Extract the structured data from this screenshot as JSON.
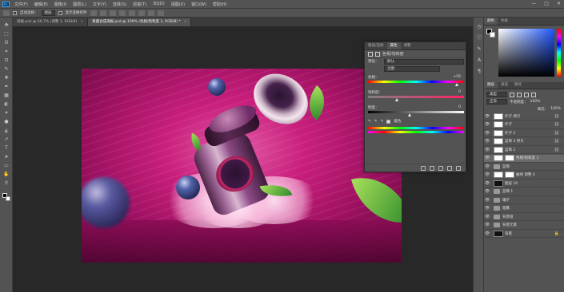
{
  "app": {
    "logo_text": "Ps"
  },
  "menu": [
    "文件(F)",
    "编辑(E)",
    "图像(I)",
    "图层(L)",
    "文字(Y)",
    "选择(S)",
    "滤镜(T)",
    "3D(D)",
    "视图(V)",
    "窗口(W)",
    "帮助(H)"
  ],
  "window_controls": {
    "minimize": "—",
    "maximize": "□",
    "close": "✕"
  },
  "options": {
    "auto_select_label": "自动选择：",
    "auto_select_value": "图层",
    "transform_label": "显示变换控件"
  },
  "tabs": [
    {
      "label": "海报.psd @ 66.7% (调整 3, RGB/8)",
      "active": false
    },
    {
      "label": "果酱合成海报.psd @ 100% (色相/饱和度 1, RGB/8) *",
      "active": true
    }
  ],
  "tab_close": "×",
  "tools": [
    "✥",
    "⬚",
    "ʘ",
    "⌗",
    "⊡",
    "✎",
    "✚",
    "✒",
    "▦",
    "◐",
    "✦",
    "●",
    "◭",
    "➚",
    "T",
    "➤",
    "▭",
    "✋",
    "⚲"
  ],
  "properties_panel": {
    "tabs": [
      "路径/选择",
      "属性",
      "调整"
    ],
    "active_tab": "属性",
    "title": "色相/饱和度",
    "preset_label": "预设：",
    "preset_value": "默认",
    "channel_value": "全图",
    "hue_label": "色相：",
    "hue_value": "+56",
    "saturation_label": "饱和度：",
    "saturation_value": "0",
    "lightness_label": "明度：",
    "lightness_value": "0",
    "colorize_label": "着色"
  },
  "color_panel": {
    "tabs": [
      "颜色",
      "色板"
    ],
    "active_tab": "颜色"
  },
  "layers_panel": {
    "tabs": [
      "图层",
      "通道",
      "路径"
    ],
    "active_tab": "图层",
    "kind_value": "类型",
    "blend_value": "正常",
    "opacity_label": "不透明度：",
    "opacity_value": "100%",
    "fill_label": "填充：",
    "fill_value": "100%",
    "layers": [
      {
        "name": "叶子 拷贝",
        "kind": "layer",
        "visible": true,
        "selected": false
      },
      {
        "name": "叶子",
        "kind": "layer",
        "visible": true,
        "selected": false
      },
      {
        "name": "叶子 2",
        "kind": "layer",
        "visible": true,
        "selected": false
      },
      {
        "name": "蓝莓 3 拷贝",
        "kind": "layer",
        "visible": true,
        "selected": false
      },
      {
        "name": "蓝莓 2",
        "kind": "layer",
        "visible": true,
        "selected": false
      },
      {
        "name": "色相/饱和度 1",
        "kind": "adjustment",
        "visible": true,
        "selected": true
      },
      {
        "name": "蓝莓",
        "kind": "group",
        "visible": true,
        "selected": false
      },
      {
        "name": "曲线 调整 4",
        "kind": "adjustment",
        "visible": true,
        "selected": false
      },
      {
        "name": "图层 16",
        "kind": "dark",
        "visible": true,
        "selected": false
      },
      {
        "name": "蓝莓 1",
        "kind": "group",
        "visible": true,
        "selected": false
      },
      {
        "name": "罐子",
        "kind": "group",
        "visible": true,
        "selected": false
      },
      {
        "name": "烟雾",
        "kind": "group",
        "visible": true,
        "selected": false
      },
      {
        "name": "背景组",
        "kind": "group",
        "visible": true,
        "selected": false
      },
      {
        "name": "背景元素",
        "kind": "group",
        "visible": true,
        "selected": false
      },
      {
        "name": "背景",
        "kind": "dark",
        "visible": true,
        "selected": false
      }
    ]
  },
  "icons": {
    "eye": "👁",
    "link": "⛓",
    "lock": "🔒"
  }
}
